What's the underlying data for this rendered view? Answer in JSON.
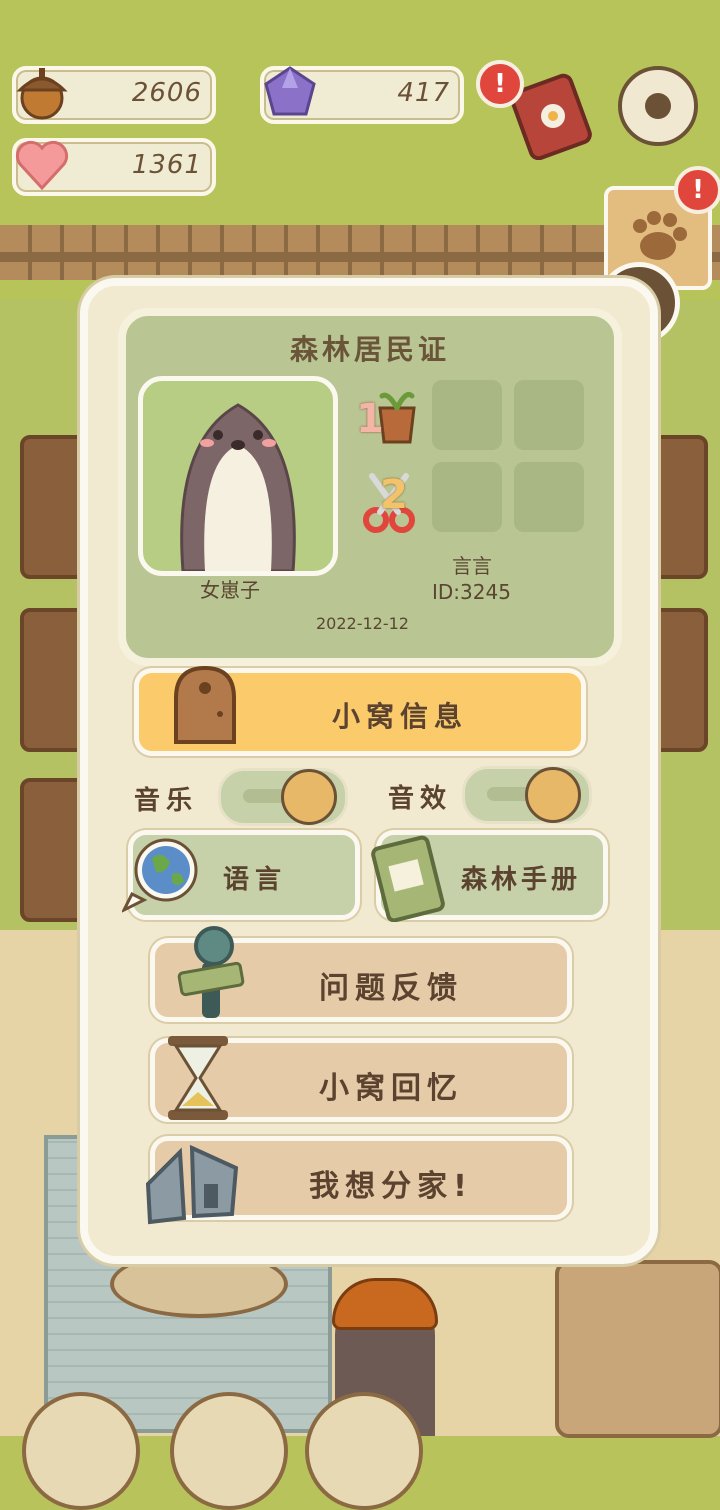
{
  "hud": {
    "acorns": "2606",
    "gems": "417",
    "hearts": "1361",
    "alert_badge": "!"
  },
  "card": {
    "title": "森林居民证",
    "gender": "女崽子",
    "name": "言言",
    "id": "ID:3245",
    "date": "2022-12-12",
    "badge_1": "1",
    "badge_2": "2"
  },
  "menu": {
    "home_info": "小窝信息",
    "music": "音乐",
    "sound": "音效",
    "language": "语言",
    "manual": "森林手册",
    "feedback": "问题反馈",
    "memories": "小窝回忆",
    "move_out": "我想分家!"
  },
  "toggles": {
    "music_on": true,
    "sound_on": true
  },
  "colors": {
    "panel": "#f2ead0",
    "accent_button": "#fbcb6b",
    "badge": "#e0463c"
  }
}
